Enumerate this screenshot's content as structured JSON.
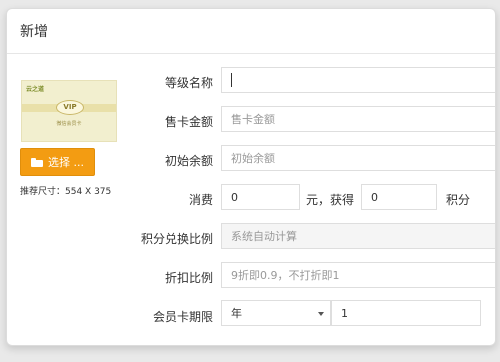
{
  "dialog": {
    "title": "新增"
  },
  "card": {
    "brand": "云之道",
    "badge": "VIP",
    "subtitle": "微信会员卡",
    "choose_label": "选择 ...",
    "size_hint": "推荐尺寸：554 X 375"
  },
  "form": {
    "level_name": {
      "label": "等级名称",
      "value": ""
    },
    "price": {
      "label": "售卡金额",
      "placeholder": "售卡金额"
    },
    "initial_balance": {
      "label": "初始余额",
      "placeholder": "初始余额"
    },
    "consume": {
      "label": "消费",
      "amount_value": "0",
      "mid_text": "元，获得",
      "points_value": "0",
      "suffix": "积分"
    },
    "points_ratio": {
      "label": "积分兑换比例",
      "placeholder": "系统自动计算"
    },
    "discount": {
      "label": "折扣比例",
      "placeholder": "9折即0.9，不打折即1"
    },
    "validity": {
      "label": "会员卡期限",
      "unit_selected": "年",
      "value": "1"
    }
  },
  "colors": {
    "accent": "#f39c12",
    "disabled_bg": "#f5f5f5",
    "border": "#dedede"
  }
}
